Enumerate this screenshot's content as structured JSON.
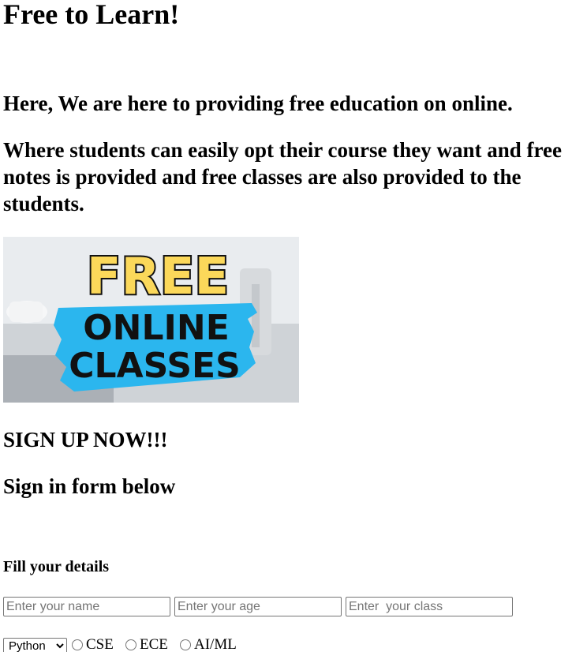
{
  "page": {
    "heading": "Free to Learn!",
    "intro": "Here, We are here to providing free education on online.",
    "description": "Where students can easily opt their course they want and free notes is provided and free classes are also provided to the students.",
    "signup_heading": "SIGN UP NOW!!!",
    "signin_heading": "Sign in form below"
  },
  "banner": {
    "line1": "FREE",
    "line2": "ONLINE",
    "line3": "CLASSES",
    "colors": {
      "yellow": "#fbd85a",
      "blue": "#2bb6ee",
      "outline": "#111111"
    }
  },
  "form": {
    "title": "Fill your details",
    "name_placeholder": "Enter your name",
    "age_placeholder": "Enter your age",
    "class_placeholder": "Enter  your class",
    "select_value": "Python",
    "radios": [
      {
        "label": "CSE"
      },
      {
        "label": "ECE"
      },
      {
        "label": "AI/ML"
      }
    ]
  }
}
